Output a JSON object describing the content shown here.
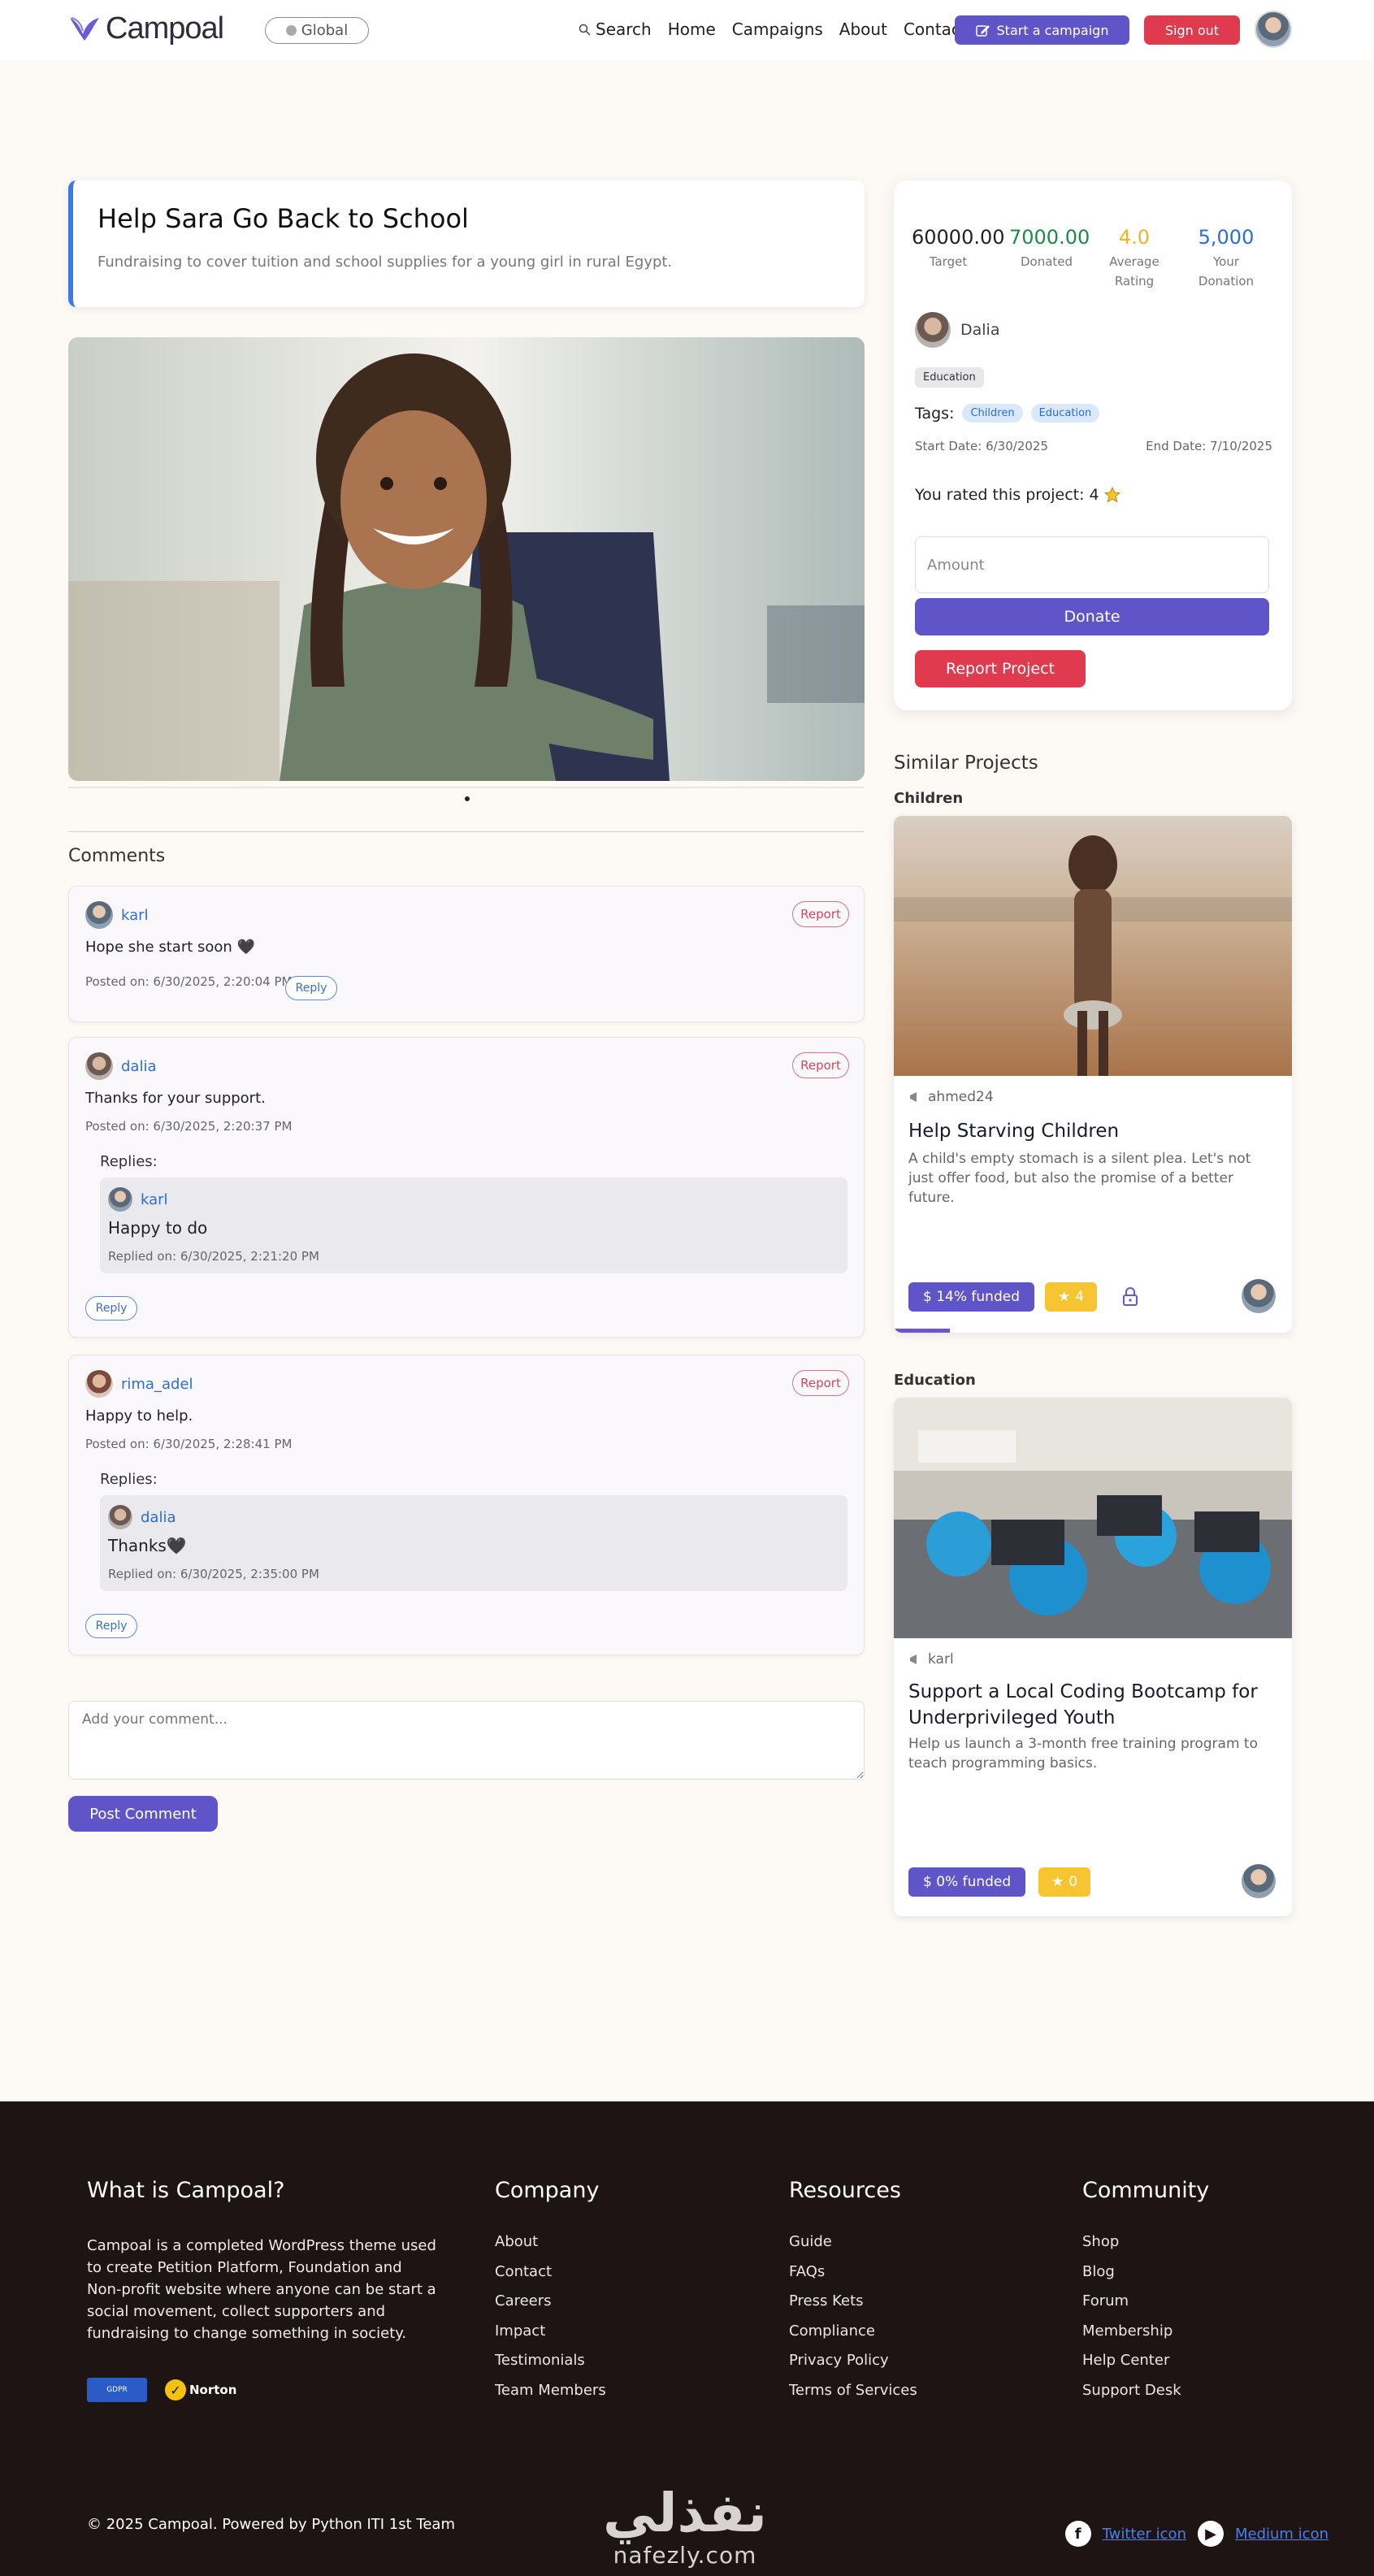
{
  "nav": {
    "logo_text": "Campoal",
    "region": "Global",
    "links": [
      "Search",
      "Home",
      "Campaigns",
      "About",
      "Contact"
    ],
    "start_campaign": "Start a campaign",
    "sign_out": "Sign out",
    "colors": {
      "primary": "#6055c8",
      "danger": "#e03a4f"
    }
  },
  "project": {
    "title": "Help Sara Go Back to School",
    "subtitle": "Fundraising to cover tuition and school supplies for a young girl in rural Egypt."
  },
  "comments": {
    "heading": "Comments",
    "report_label": "Report",
    "reply_label": "Reply",
    "replies_label": "Replies:",
    "items": [
      {
        "user": "karl",
        "text": "Hope she start soon 🖤",
        "posted": "Posted on: 6/30/2025, 2:20:04 PM",
        "replies": []
      },
      {
        "user": "dalia",
        "text": "Thanks for your support.",
        "posted": "Posted on: 6/30/2025, 2:20:37 PM",
        "replies": [
          {
            "user": "karl",
            "text": "Happy to do",
            "replied": "Replied on: 6/30/2025, 2:21:20 PM"
          }
        ]
      },
      {
        "user": "rima_adel",
        "text": "Happy to help.",
        "posted": "Posted on: 6/30/2025, 2:28:41 PM",
        "replies": [
          {
            "user": "dalia",
            "text": "Thanks🖤",
            "replied": "Replied on: 6/30/2025, 2:35:00 PM"
          }
        ]
      }
    ],
    "input_placeholder": "Add your comment...",
    "post_button": "Post Comment"
  },
  "stats": {
    "target_value": "60000.00",
    "target_label": "Target",
    "donated_value": "7000.00",
    "donated_label": "Donated",
    "rating_value": "4.0",
    "rating_label": "Average Rating",
    "your_value": "5,000",
    "your_label": "Your Donation",
    "colors": {
      "target": "#222222",
      "donated": "#1e8a4a",
      "rating": "#f0b429",
      "your": "#2a6ed6"
    }
  },
  "info": {
    "owner": "Dalia",
    "category": "Education",
    "tags_label": "Tags:",
    "tags": [
      "Children",
      "Education"
    ],
    "start_date": "Start Date: 6/30/2025",
    "end_date": "End Date: 7/10/2025",
    "rated_text": "You rated this project:",
    "rated_value": "4",
    "amount_placeholder": "Amount",
    "donate_button": "Donate",
    "report_button": "Report Project"
  },
  "similar": {
    "heading": "Similar Projects",
    "groups": [
      {
        "category": "Children",
        "author": "ahmed24",
        "title": "Help Starving Children",
        "description": "A child's empty stomach is a silent plea. Let's not just offer food, but also the promise of a better future.",
        "funded": "$ 14% funded",
        "funded_fraction": 0.14,
        "rating": "4",
        "locked": true
      },
      {
        "category": "Education",
        "author": "karl",
        "title": "Support a Local Coding Bootcamp for Underprivileged Youth",
        "description": "Help us launch a 3-month free training program to teach programming basics.",
        "funded": "$ 0% funded",
        "funded_fraction": 0,
        "rating": "0",
        "locked": false
      }
    ]
  },
  "footer": {
    "about_title": "What is Campoal?",
    "about_text": "Campoal is a completed WordPress theme used to create Petition Platform, Foundation and Non-profit website where anyone can be start a social movement, collect supporters and fundraising to change something in society.",
    "company_title": "Company",
    "company_links": [
      "About",
      "Contact",
      "Careers",
      "Impact",
      "Testimonials",
      "Team Members"
    ],
    "resources_title": "Resources",
    "resources_links": [
      "Guide",
      "FAQs",
      "Press Kets",
      "Compliance",
      "Privacy Policy",
      "Terms of Services"
    ],
    "community_title": "Community",
    "community_links": [
      "Shop",
      "Blog",
      "Forum",
      "Membership",
      "Help Center",
      "Support Desk"
    ],
    "badge_gdpr": "GDPR",
    "badge_norton": "Norton",
    "copyright": "© 2025 Campoal. Powered by Python ITI 1st Team",
    "watermark_ar": "نفذلي",
    "watermark_en": "nafezly.com",
    "twitter_alt": "Twitter icon",
    "medium_alt": "Medium icon"
  }
}
